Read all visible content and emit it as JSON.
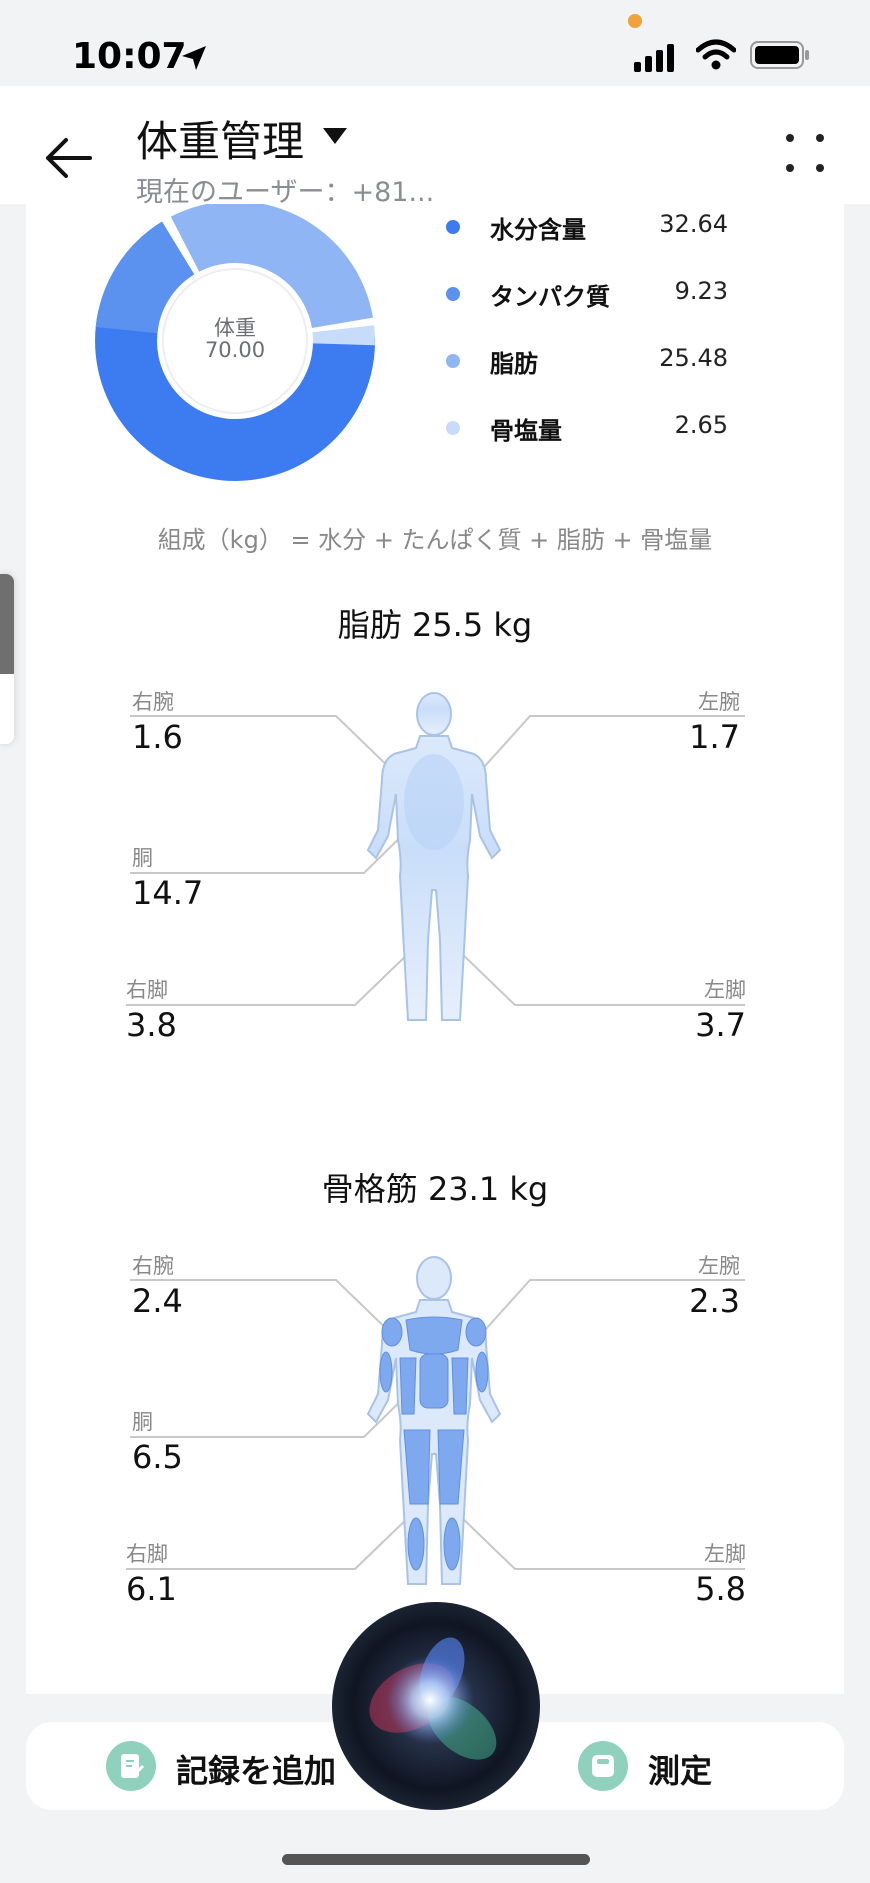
{
  "status_bar": {
    "time": "10:07"
  },
  "header": {
    "title": "体重管理",
    "subtitle": "現在のユーザー：+81..."
  },
  "composition": {
    "center_label": "体重",
    "center_value": "70.00",
    "legend": [
      {
        "label": "水分含量",
        "value": "32.64",
        "color": "#3d7cf0"
      },
      {
        "label": "タンパク質",
        "value": "9.23",
        "color": "#5b91ef"
      },
      {
        "label": "脂肪",
        "value": "25.48",
        "color": "#8fb5f5"
      },
      {
        "label": "骨塩量",
        "value": "2.65",
        "color": "#c7dbfb"
      }
    ],
    "formula": "組成（kg） = 水分 + たんぱく質 + 脂肪 + 骨塩量"
  },
  "fat": {
    "title": "脂肪 25.5 kg",
    "right_arm_label": "右腕",
    "right_arm_value": "1.6",
    "left_arm_label": "左腕",
    "left_arm_value": "1.7",
    "trunk_label": "胴",
    "trunk_value": "14.7",
    "right_leg_label": "右脚",
    "right_leg_value": "3.8",
    "left_leg_label": "左脚",
    "left_leg_value": "3.7"
  },
  "muscle": {
    "title": "骨格筋 23.1 kg",
    "right_arm_label": "右腕",
    "right_arm_value": "2.4",
    "left_arm_label": "左腕",
    "left_arm_value": "2.3",
    "trunk_label": "胴",
    "trunk_value": "6.5",
    "right_leg_label": "右脚",
    "right_leg_value": "6.1",
    "left_leg_label": "左脚",
    "left_leg_value": "5.8"
  },
  "bottom": {
    "add_record": "記録を追加",
    "measure": "測定"
  }
}
